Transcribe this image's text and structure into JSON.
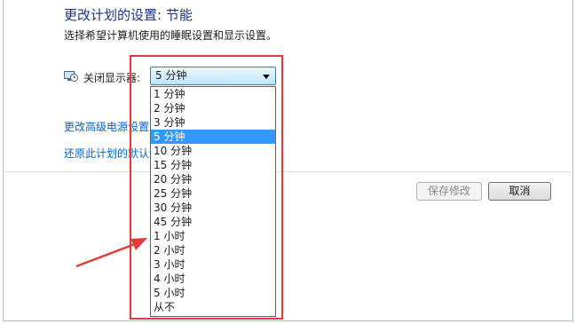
{
  "page": {
    "title": "更改计划的设置: 节能",
    "subtitle": "选择希望计算机使用的睡眠设置和显示设置。"
  },
  "display_setting": {
    "label": "关闭显示器:",
    "icon": "monitor-clock-icon",
    "selected": "5 分钟",
    "options": [
      "1 分钟",
      "2 分钟",
      "3 分钟",
      "5 分钟",
      "10 分钟",
      "15 分钟",
      "20 分钟",
      "25 分钟",
      "30 分钟",
      "45 分钟",
      "1 小时",
      "2 小时",
      "3 小时",
      "4 小时",
      "5 小时",
      "从不"
    ]
  },
  "links": {
    "advanced": "更改高级电源设置(C",
    "restore": "还原此计划的默认设"
  },
  "buttons": {
    "save": "保存修改",
    "cancel": "取消"
  },
  "colors": {
    "title": "#1e3287",
    "link": "#0066cc",
    "selection": "#3399ff",
    "annotation": "#e53a3a"
  }
}
